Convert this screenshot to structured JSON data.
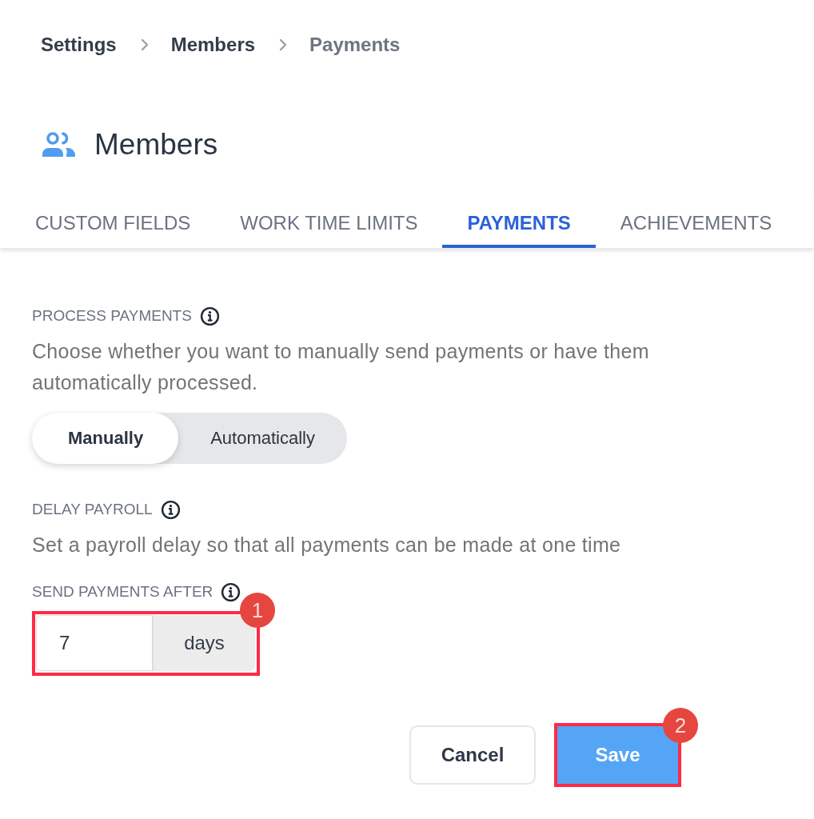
{
  "breadcrumb": [
    {
      "label": "Settings",
      "current": false
    },
    {
      "label": "Members",
      "current": false
    },
    {
      "label": "Payments",
      "current": true
    }
  ],
  "page_title": "Members",
  "tabs": [
    {
      "label": "CUSTOM FIELDS",
      "selected": false
    },
    {
      "label": "WORK TIME LIMITS",
      "selected": false
    },
    {
      "label": "PAYMENTS",
      "selected": true
    },
    {
      "label": "ACHIEVEMENTS",
      "selected": false
    }
  ],
  "sections": [
    {
      "kind": "segmented",
      "label": "PROCESS PAYMENTS",
      "description": "Choose whether you want to manually send payments or have them automatically processed.",
      "options": [
        {
          "label": "Manually",
          "selected": true
        },
        {
          "label": "Automatically",
          "selected": false
        }
      ]
    },
    {
      "kind": "text",
      "label": "DELAY PAYROLL",
      "description": "Set a payroll delay so that all payments can be made at one time"
    },
    {
      "kind": "number",
      "label": "SEND PAYMENTS AFTER",
      "value": "7",
      "unit": "days",
      "highlighted": true,
      "badge": "1"
    }
  ],
  "buttons": [
    {
      "label": "Cancel",
      "kind": "secondary",
      "highlighted": false
    },
    {
      "label": "Save",
      "kind": "primary",
      "highlighted": true,
      "badge": "2"
    }
  ]
}
